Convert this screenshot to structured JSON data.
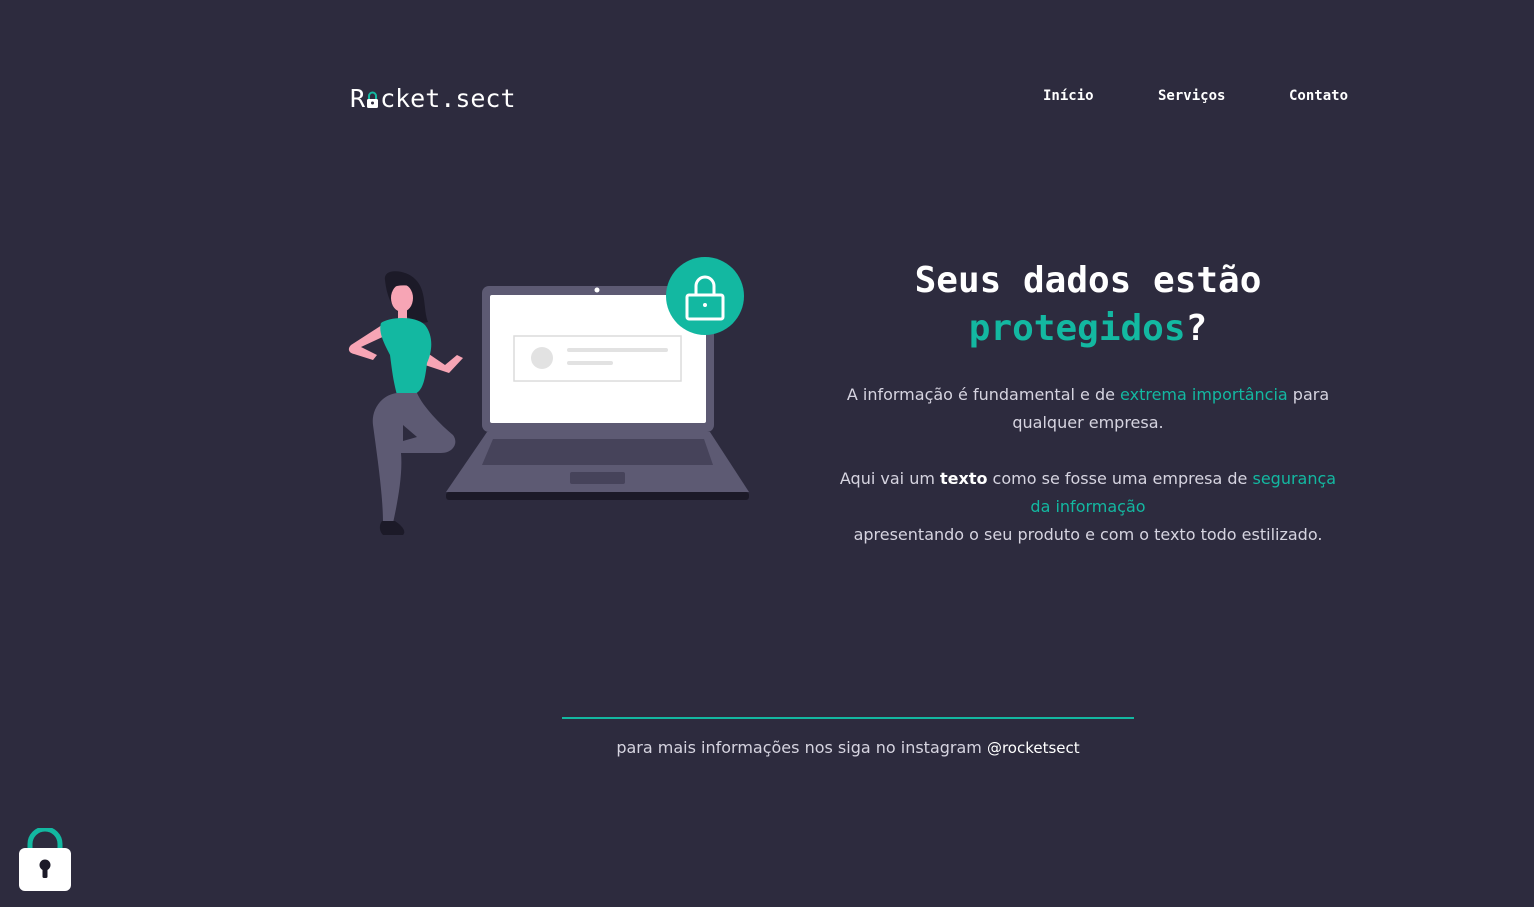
{
  "header": {
    "logo_prefix": "R",
    "logo_suffix": "cket.sect",
    "nav": [
      "Início",
      "Serviços",
      "Contato"
    ]
  },
  "hero": {
    "title_line1": "Seus dados estão",
    "title_accent": "protegidos",
    "title_end": "?",
    "p1_a": "A informação é fundamental e de ",
    "p1_hl": "extrema importância",
    "p1_b": " para qualquer empresa.",
    "p2_a": "Aqui vai um ",
    "p2_bold": "texto",
    "p2_b": " como se fosse uma empresa de ",
    "p2_hl": "segurança da informação",
    "p2_c": "apresentando o seu produto e com o texto todo estilizado."
  },
  "footer": {
    "text": "para mais informações nos siga no instagram ",
    "handle": "@rocketsect"
  },
  "colors": {
    "background": "#2d2b3e",
    "accent": "#13b8a1",
    "text": "#ffffff",
    "muted_text": "#d6d4e0"
  },
  "icons": [
    "lock-icon",
    "padlock-badge-icon",
    "floating-lock-icon"
  ]
}
